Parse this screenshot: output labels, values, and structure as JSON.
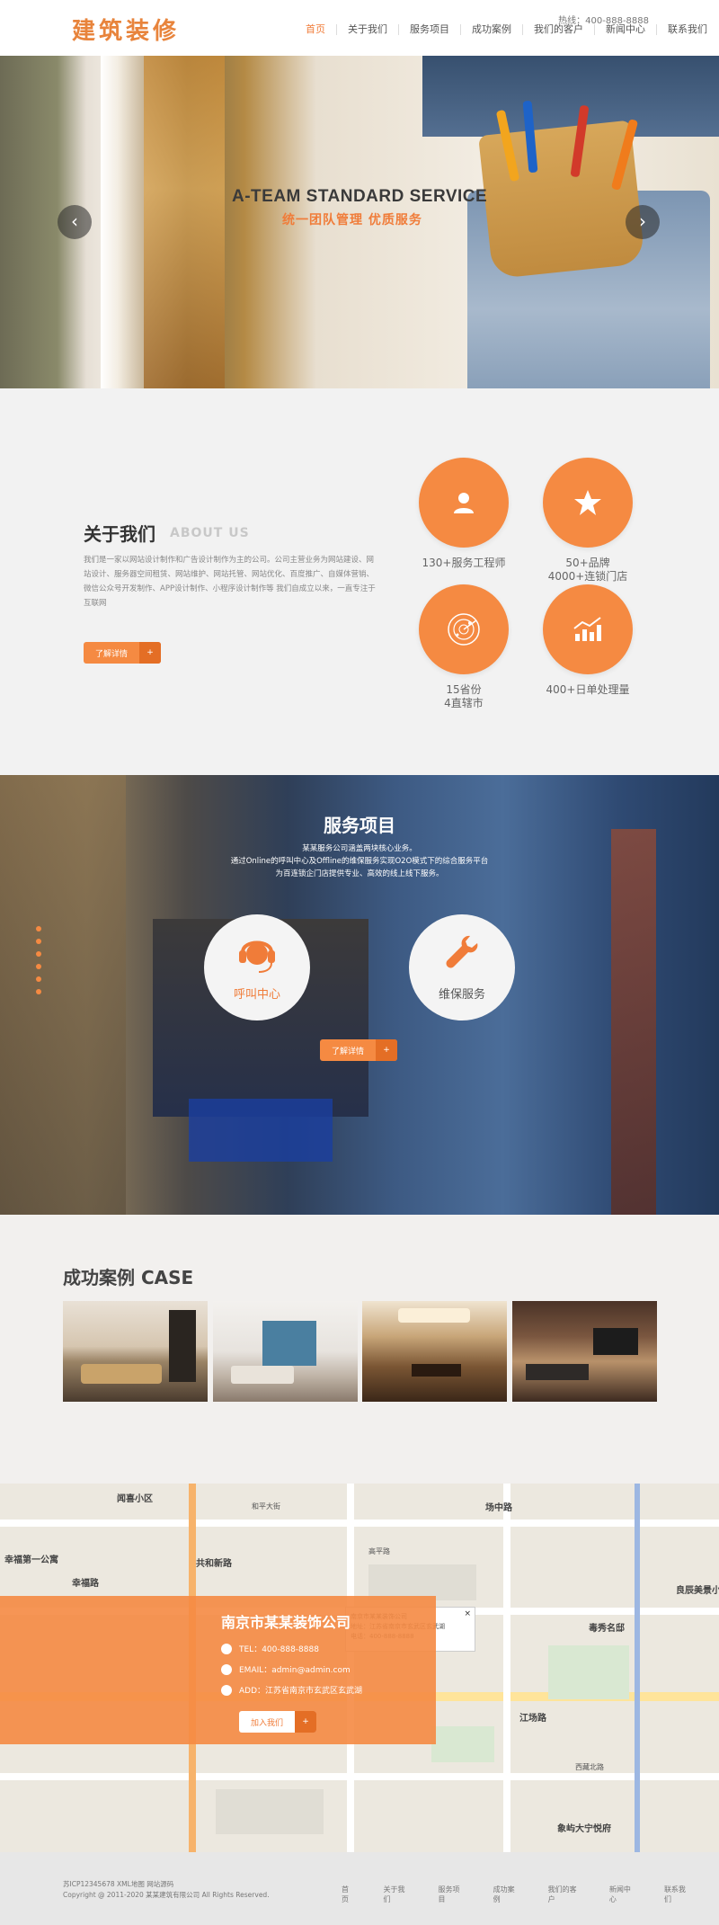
{
  "header": {
    "logo": "建筑装修",
    "hotline": "热线：400-888-8888",
    "nav": [
      "首页",
      "关于我们",
      "服务项目",
      "成功案例",
      "我们的客户",
      "新闻中心",
      "联系我们"
    ]
  },
  "banner": {
    "headline": "A-TEAM STANDARD SERVICE",
    "subheadline": "统一团队管理  优质服务",
    "prev_icon": "chevron-left-icon",
    "next_icon": "chevron-right-icon"
  },
  "about": {
    "title": "关于我们",
    "title_en": "ABOUT US",
    "text": "我们是一家以网站设计制作和广告设计制作为主的公司。公司主营业务为网站建设、网站设计、服务器空间租赁、网站维护、网站托管、网站优化、百度推广、自媒体营销、微信公众号开发制作、APP设计制作、小程序设计制作等 我们自成立以来，一直专注于互联网",
    "button_label": "了解详情",
    "button_plus": "+",
    "stats": [
      {
        "icon": "user-icon",
        "label": "130+服务工程师"
      },
      {
        "icon": "star-icon",
        "label": "50+品牌\n4000+连锁门店"
      },
      {
        "icon": "radar-icon",
        "label": "15省份\n4直辖市"
      },
      {
        "icon": "chart-up-icon",
        "label": "400+日单处理量"
      }
    ]
  },
  "services": {
    "title": "服务项目",
    "desc_lines": [
      "某某服务公司涵盖两块核心业务。",
      "通过Online的呼叫中心及Offline的维保服务实现O2O模式下的综合服务平台",
      "为百连锁企门店提供专业、高效的线上线下服务。"
    ],
    "items": [
      {
        "icon": "headset-icon",
        "label": "呼叫中心"
      },
      {
        "icon": "wrench-icon",
        "label": "维保服务"
      }
    ],
    "button_label": "了解详情",
    "button_plus": "+"
  },
  "cases": {
    "title": "成功案例 CASE",
    "images": [
      "case-living-room-1",
      "case-living-room-2",
      "case-living-room-3",
      "case-living-room-4"
    ]
  },
  "map": {
    "labels": {
      "l1": "闻喜小区",
      "l2": "和平大街",
      "l3": "共和新路",
      "l4": "场中路",
      "l5": "幸福路",
      "l6": "江场路",
      "l7": "毒秀名邸",
      "l8": "象屿大宁悦府",
      "l9": "高平路",
      "l10": "幸福第一公寓",
      "l11": "西藏北路",
      "l12": "良辰美景小区"
    },
    "popup": {
      "title": "南京市某某装饰公司",
      "address": "地址：江苏省南京市玄武区玄武湖",
      "tel": "电话：400-888-8888"
    },
    "company": "南京市某某装饰公司",
    "tel": "TEL：400-888-8888",
    "email": "EMAIL：admin@admin.com",
    "address": "ADD：江苏省南京市玄武区玄武湖",
    "button_label": "加入我们",
    "button_plus": "+"
  },
  "footer": {
    "icp": "苏ICP12345678 XML地图 网站源码",
    "copyright": "Copyright @ 2011-2020 某某建筑有限公司 All Rights Reserved.",
    "nav": [
      "首页",
      "关于我们",
      "服务项目",
      "成功案例",
      "我们的客户",
      "新闻中心",
      "联系我们"
    ]
  },
  "colors": {
    "accent": "#f58a42",
    "accent_dark": "#e46e25",
    "logo": "#e8843c"
  }
}
